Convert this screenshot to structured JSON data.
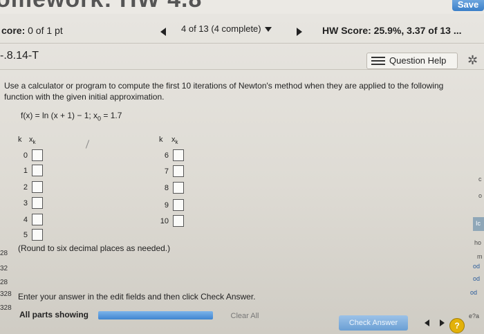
{
  "header": {
    "title_fragment": "omework: HW 4.8",
    "save_label": "Save"
  },
  "score_bar": {
    "score_label": "core:",
    "score_value": "0 of 1 pt",
    "question_select": "4 of 13 (4 complete)",
    "hw_score": "HW Score: 25.9%, 3.37 of 13 ..."
  },
  "problem": {
    "id": "-.8.14-T",
    "question_help_label": "Question Help",
    "instructions": "Use a calculator or program to compute the first 10 iterations of Newton's method when they are applied to the following function with the given initial approximation.",
    "function_main": "f(x) = ln (x + 1) − 1; x",
    "function_sub": "0",
    "function_tail": " = 1.7",
    "col_k": "k",
    "col_x": "x",
    "col_x_sub": "k",
    "left_k": [
      "0",
      "1",
      "2",
      "3",
      "4",
      "5"
    ],
    "right_k": [
      "6",
      "7",
      "8",
      "9",
      "10"
    ],
    "round_note": "(Round to six decimal places as needed.)"
  },
  "footer": {
    "enter_note": "Enter your answer in the edit fields and then click Check Answer.",
    "parts_showing": "All parts showing",
    "progress": 1.0,
    "clear_all": "Clear All",
    "check_answer": "Check Answer",
    "help_badge": "?"
  },
  "side_windows": {
    "left": [
      "28",
      "32",
      "28",
      "328",
      "328"
    ],
    "right": [
      "c",
      "o",
      "Ic",
      "ho",
      "m",
      "od",
      "od",
      "od",
      "e?a"
    ]
  }
}
